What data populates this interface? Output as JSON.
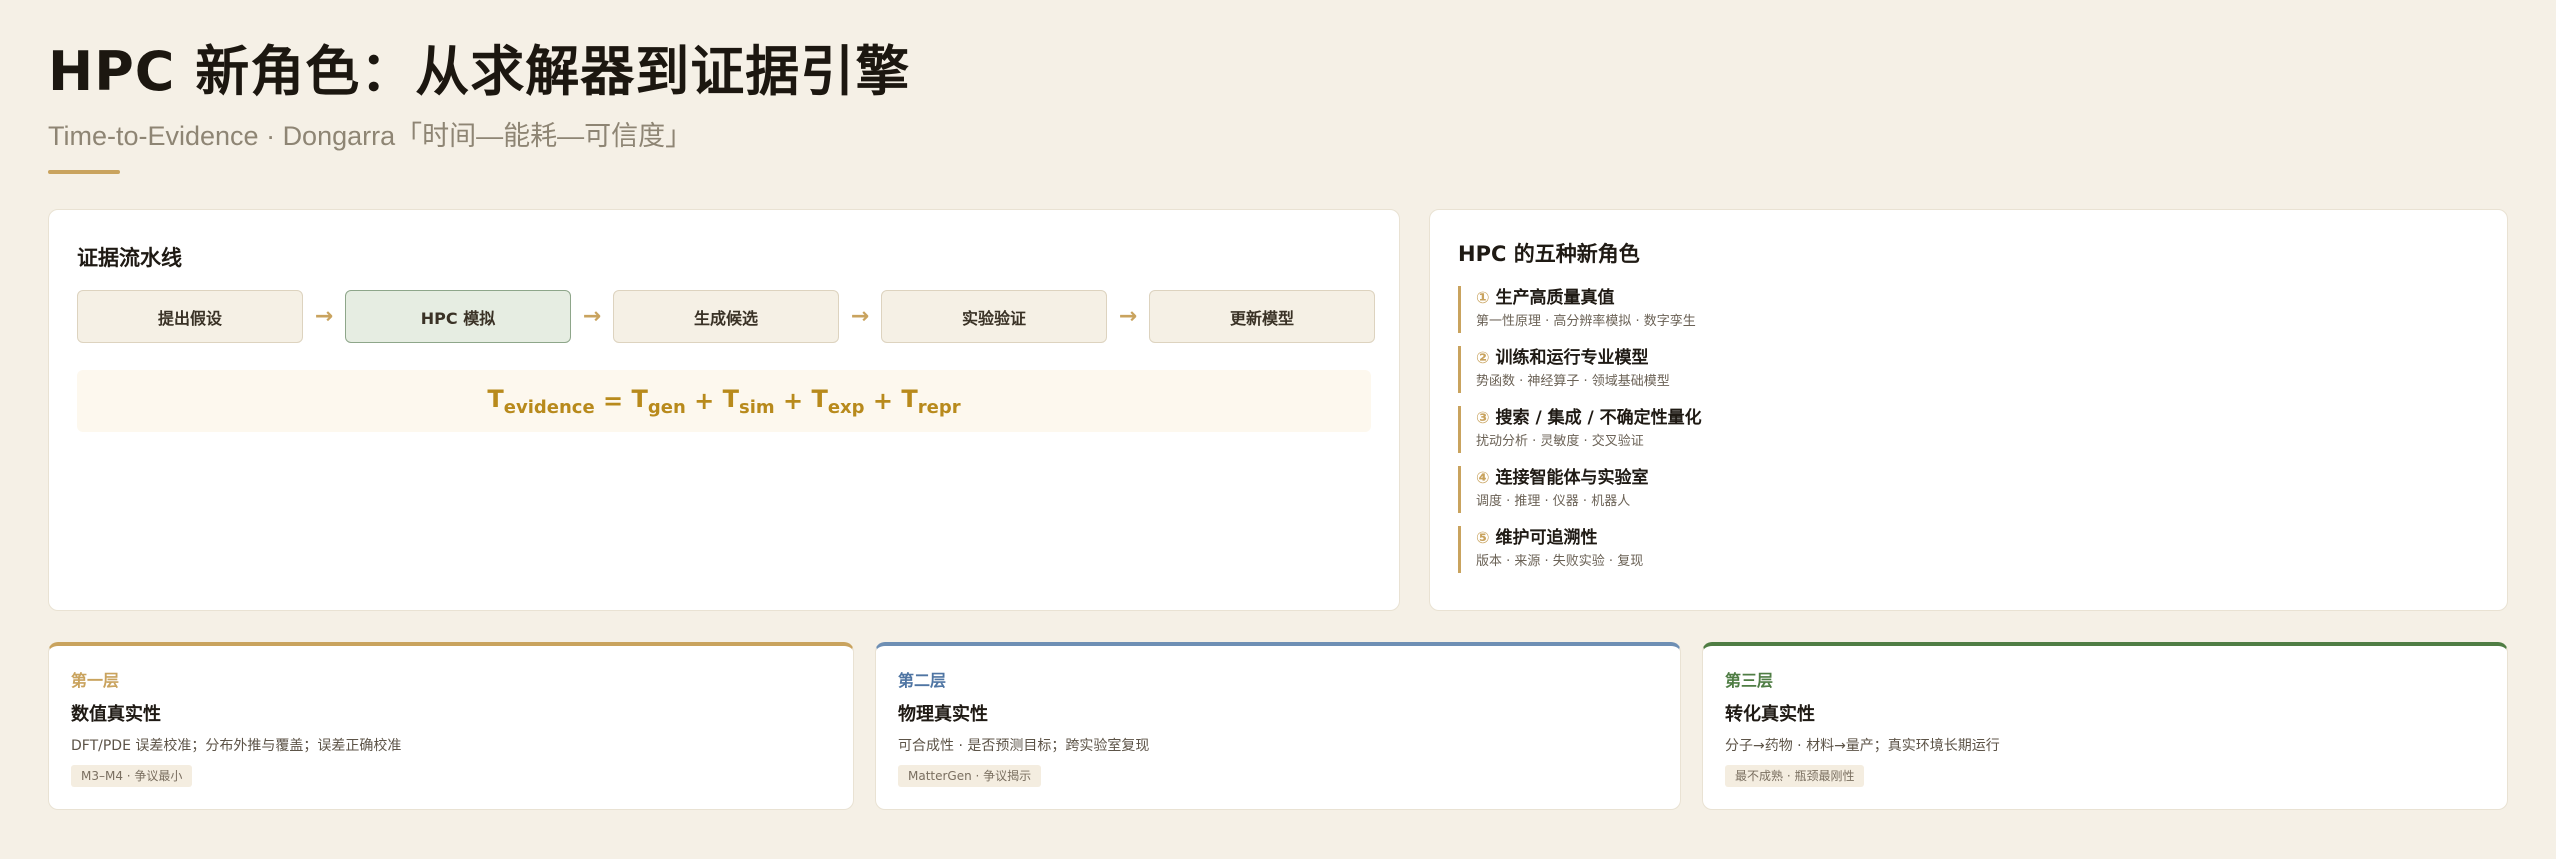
{
  "header": {
    "title": "HPC 新角色：从求解器到证据引擎",
    "subtitle": "Time-to-Evidence · Dongarra「时间—能耗—可信度」"
  },
  "pipeline": {
    "title": "证据流水线",
    "steps": [
      {
        "label": "提出假设",
        "active": false
      },
      {
        "label": "HPC 模拟",
        "active": true
      },
      {
        "label": "生成候选",
        "active": false
      },
      {
        "label": "实验验证",
        "active": false
      },
      {
        "label": "更新模型",
        "active": false
      }
    ],
    "arrow": "→",
    "formula": {
      "lhs": "T",
      "lhs_sub": "evidence",
      "eq": " = ",
      "terms": [
        {
          "base": "T",
          "sub": "gen"
        },
        {
          "base": "T",
          "sub": "sim"
        },
        {
          "base": "T",
          "sub": "exp"
        },
        {
          "base": "T",
          "sub": "repr"
        }
      ],
      "plus": " + "
    }
  },
  "roles": {
    "title": "HPC 的五种新角色",
    "items": [
      {
        "num": "①",
        "title": "生产高质量真值",
        "desc": "第一性原理 · 高分辨率模拟 · 数字孪生"
      },
      {
        "num": "②",
        "title": "训练和运行专业模型",
        "desc": "势函数 · 神经算子 · 领域基础模型"
      },
      {
        "num": "③",
        "title": "搜索 / 集成 / 不确定性量化",
        "desc": "扰动分析 · 灵敏度 · 交叉验证"
      },
      {
        "num": "④",
        "title": "连接智能体与实验室",
        "desc": "调度 · 推理 · 仪器 · 机器人"
      },
      {
        "num": "⑤",
        "title": "维护可追溯性",
        "desc": "版本 · 来源 · 失败实验 · 复现"
      }
    ]
  },
  "layers": [
    {
      "tag": "第一层",
      "title": "数值真实性",
      "desc": "DFT/PDE 误差校准；分布外推与覆盖；误差正确校准",
      "chip": "M3–M4 · 争议最小"
    },
    {
      "tag": "第二层",
      "title": "物理真实性",
      "desc": "可合成性 · 是否预测目标；跨实验室复现",
      "chip": "MatterGen · 争议揭示"
    },
    {
      "tag": "第三层",
      "title": "转化真实性",
      "desc": "分子→药物 · 材料→量产；真实环境长期运行",
      "chip": "最不成熟 · 瓶颈最刚性"
    }
  ],
  "colors": {
    "background": "#f5f0e6",
    "accent_gold": "#c9a35e",
    "layer_blue": "#6e8fb4",
    "layer_green": "#4f7d44",
    "formula": "#b88a1c"
  }
}
